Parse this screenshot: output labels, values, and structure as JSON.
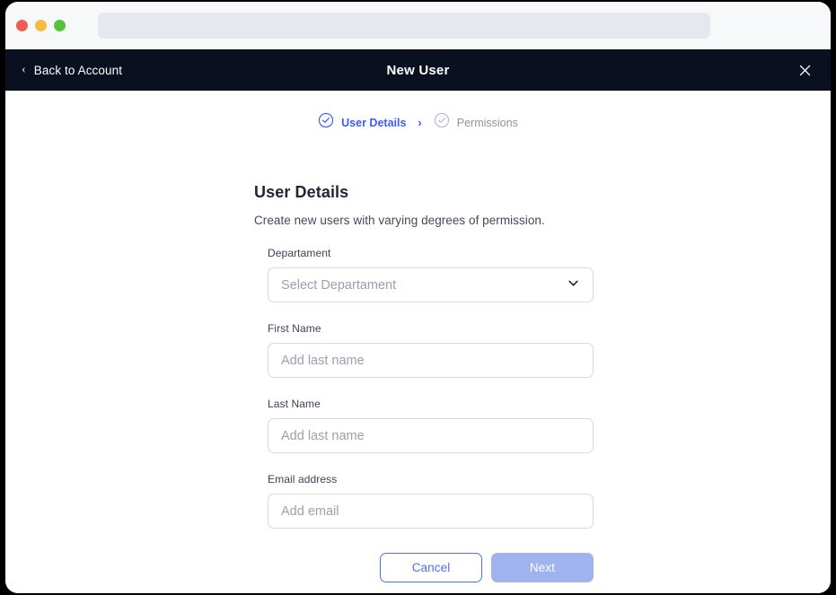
{
  "browser": {
    "traffic_lights": [
      "close-light",
      "minimize-light",
      "maximize-light"
    ],
    "address_bar_value": "",
    "address_bar_placeholder": ""
  },
  "modal_header": {
    "back_label": "Back to Account",
    "back_icon": "chevron-left-icon",
    "title": "New User",
    "close_icon": "close-icon"
  },
  "stepper": {
    "separator": "›",
    "steps": [
      {
        "label": "User Details",
        "state": "active",
        "icon": "check-circle-icon"
      },
      {
        "label": "Permissions",
        "state": "inactive",
        "icon": "check-circle-icon"
      }
    ]
  },
  "form": {
    "title": "User Details",
    "subtitle": "Create new users with varying degrees of permission.",
    "fields": [
      {
        "label": "Departament",
        "type": "select",
        "value": "",
        "placeholder": "Select Departament",
        "icon": "chevron-down-icon"
      },
      {
        "label": "First Name",
        "type": "text",
        "value": "",
        "placeholder": "Add last name"
      },
      {
        "label": "Last Name",
        "type": "text",
        "value": "",
        "placeholder": "Add last name"
      },
      {
        "label": "Email address",
        "type": "email",
        "value": "",
        "placeholder": "Add email"
      }
    ],
    "actions": {
      "cancel_label": "Cancel",
      "next_label": "Next"
    }
  },
  "colors": {
    "header_bg": "#0b1021",
    "accent_blue": "#3d5afe",
    "cancel_border": "#4f6ef7",
    "next_bg": "#9fb3ee",
    "muted_text": "#8c93a5",
    "border": "#d5d9e2"
  }
}
